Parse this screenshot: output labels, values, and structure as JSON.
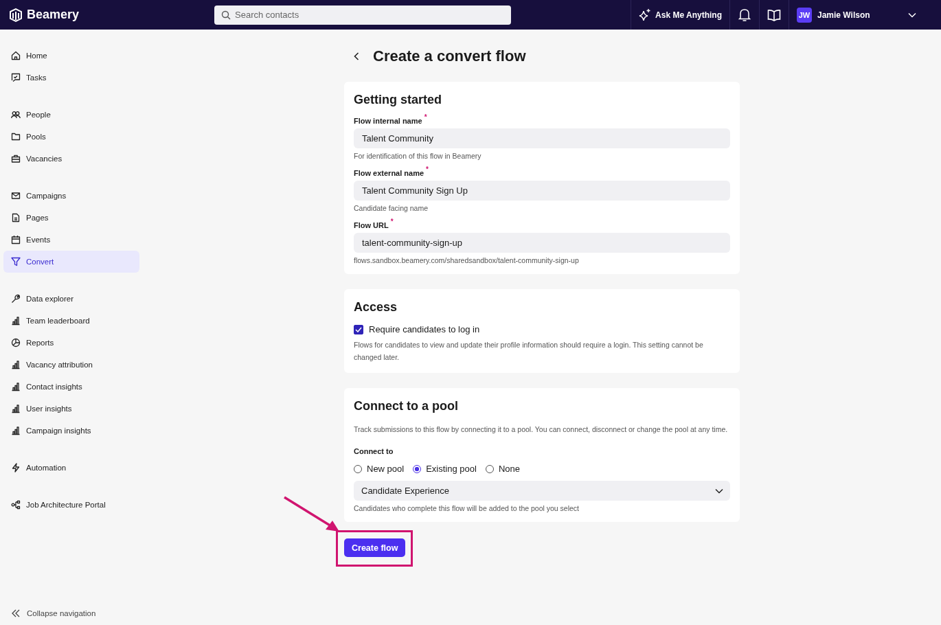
{
  "topbar": {
    "brand": "Beamery",
    "search": {
      "placeholder": "Search contacts"
    },
    "ask_button": "Ask Me Anything",
    "user": {
      "initials": "JW",
      "name": "Jamie Wilson"
    }
  },
  "sidebar": {
    "groups": [
      {
        "items": [
          {
            "label": "Home",
            "selected": false
          },
          {
            "label": "Tasks",
            "selected": false
          }
        ]
      },
      {
        "items": [
          {
            "label": "People",
            "selected": false
          },
          {
            "label": "Pools",
            "selected": false
          },
          {
            "label": "Vacancies",
            "selected": false
          }
        ]
      },
      {
        "items": [
          {
            "label": "Campaigns",
            "selected": false
          },
          {
            "label": "Pages",
            "selected": false
          },
          {
            "label": "Events",
            "selected": false
          },
          {
            "label": "Convert",
            "selected": true
          }
        ]
      },
      {
        "items": [
          {
            "label": "Data explorer",
            "selected": false
          },
          {
            "label": "Team leaderboard",
            "selected": false
          },
          {
            "label": "Reports",
            "selected": false
          },
          {
            "label": "Vacancy attribution",
            "selected": false
          },
          {
            "label": "Contact insights",
            "selected": false
          },
          {
            "label": "User insights",
            "selected": false
          },
          {
            "label": "Campaign insights",
            "selected": false
          }
        ]
      },
      {
        "items": [
          {
            "label": "Automation",
            "selected": false
          }
        ]
      },
      {
        "items": [
          {
            "label": "Job Architecture Portal",
            "selected": false
          }
        ]
      }
    ],
    "collapse": "Collapse navigation"
  },
  "page": {
    "title": "Create a convert flow",
    "getting_started": {
      "heading": "Getting started",
      "fields": [
        {
          "label": "Flow internal name",
          "required_mark": "*",
          "value": "Talent Community",
          "help": "For identification of this flow in Beamery"
        },
        {
          "label": "Flow external name",
          "required_mark": "*",
          "value": "Talent Community Sign Up",
          "help": "Candidate facing name"
        },
        {
          "label": "Flow URL",
          "required_mark": "*",
          "value": "talent-community-sign-up",
          "help": "flows.sandbox.beamery.com/sharedsandbox/talent-community-sign-up"
        }
      ]
    },
    "access": {
      "heading": "Access",
      "checkbox": {
        "label": "Require candidates to log in",
        "checked": true
      },
      "help": "Flows for candidates to view and update their profile information should require a login. This setting cannot be changed later."
    },
    "pool": {
      "heading": "Connect to a pool",
      "description": "Track submissions to this flow by connecting it to a pool. You can connect, disconnect or change the pool at any time.",
      "connect_label": "Connect to",
      "options": [
        {
          "label": "New pool",
          "selected": false
        },
        {
          "label": "Existing pool",
          "selected": true
        },
        {
          "label": "None",
          "selected": false
        }
      ],
      "select": {
        "value": "Candidate Experience"
      },
      "help": "Candidates who complete this flow will be added to the pool you select"
    },
    "submit": "Create flow"
  }
}
